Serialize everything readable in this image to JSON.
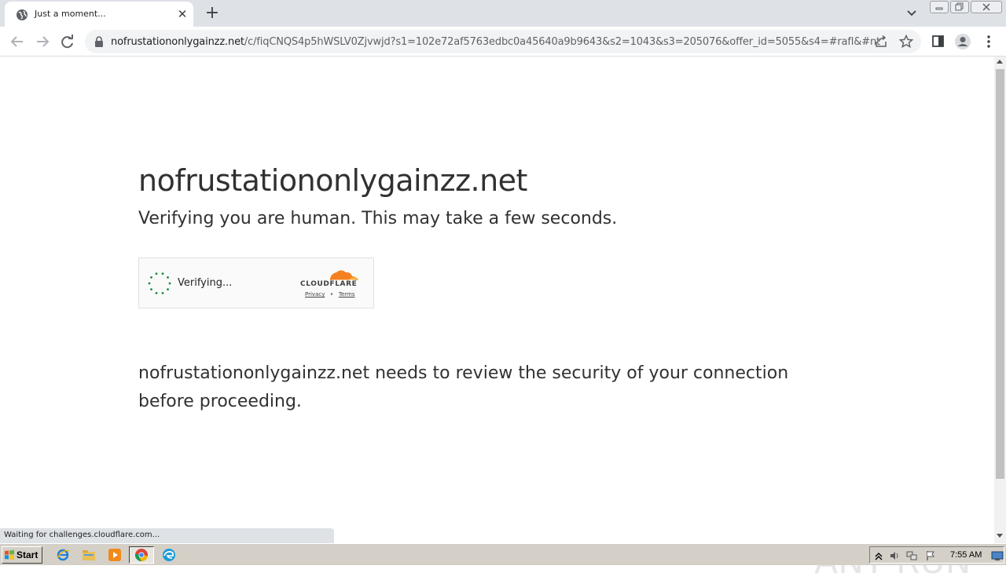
{
  "browser": {
    "tab_title": "Just a moment...",
    "url_host": "nofrustationonlygainzz.net",
    "url_path": "/c/fiqCNQS4p5hWSLV0Zjvwjd?s1=102e72af5763edbc0a45640a9b9643&s2=1043&s3=205076&offer_id=5055&s4=#rafl&#nt",
    "status_text": "Waiting for challenges.cloudflare.com..."
  },
  "page": {
    "heading": "nofrustationonlygainzz.net",
    "subheading": "Verifying you are human. This may take a few seconds.",
    "widget": {
      "status": "Verifying...",
      "brand": "CLOUDFLARE",
      "privacy_link": "Privacy",
      "separator": "•",
      "terms_link": "Terms"
    },
    "message": "nofrustationonlygainzz.net needs to review the security of your connection before proceeding."
  },
  "taskbar": {
    "start_label": "Start",
    "clock": "7:55 AM"
  },
  "watermark_text": "ANY RUN",
  "colors": {
    "cloudflare_orange": "#f48120",
    "spinner_green": "#1e8a3c"
  }
}
